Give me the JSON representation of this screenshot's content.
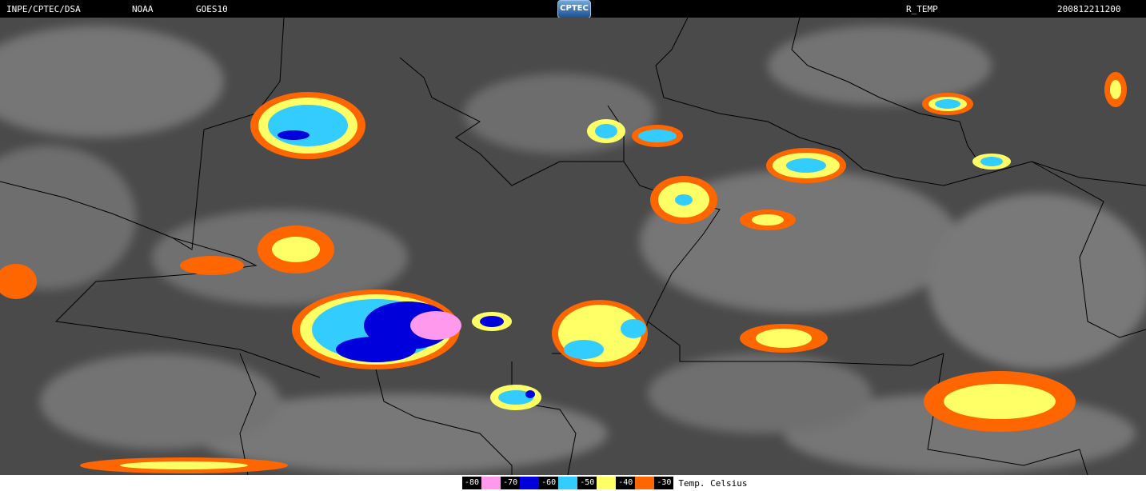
{
  "header": {
    "source": "INPE/CPTEC/DSA",
    "agency": "NOAA",
    "satellite": "GOES10",
    "logo_text": "CPTEC",
    "product": "R_TEMP",
    "timestamp": "200812211200"
  },
  "legend": {
    "items": [
      {
        "label": "-80",
        "color": "#ff99ee"
      },
      {
        "label": "-70",
        "color": "#0000dd"
      },
      {
        "label": "-60",
        "color": "#33ccff"
      },
      {
        "label": "-50",
        "color": "#ffff66"
      },
      {
        "label": "-40",
        "color": "#ff6600"
      },
      {
        "label": "-30",
        "color": "#000000"
      }
    ],
    "unit": "Temp. Celsius"
  },
  "colors": {
    "background": "#4a4a4a",
    "cloud": "#bdbdbd",
    "border_line": "#000000"
  }
}
